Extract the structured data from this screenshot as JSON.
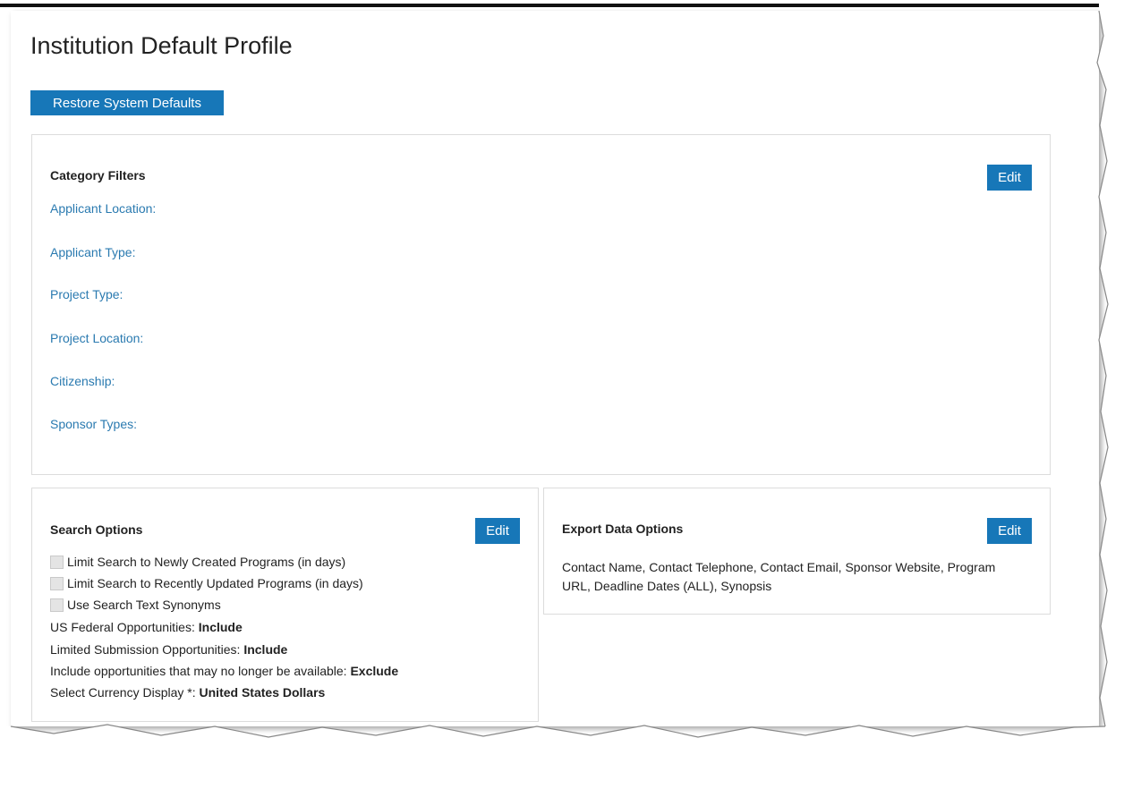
{
  "page": {
    "title": "Institution Default Profile",
    "restore_label": "Restore System Defaults"
  },
  "category_filters": {
    "title": "Category Filters",
    "edit_label": "Edit",
    "items": [
      "Applicant Location:",
      "Applicant Type:",
      "Project Type:",
      "Project Location:",
      "Citizenship:",
      "Sponsor Types:"
    ]
  },
  "search_options": {
    "title": "Search Options",
    "edit_label": "Edit",
    "checkboxes": [
      {
        "label": "Limit Search to Newly Created Programs (in days)",
        "checked": false
      },
      {
        "label": "Limit Search to Recently Updated Programs (in days)",
        "checked": false
      },
      {
        "label": "Use Search Text Synonyms",
        "checked": false
      }
    ],
    "settings": [
      {
        "label": "US Federal Opportunities: ",
        "value": "Include"
      },
      {
        "label": "Limited Submission Opportunities: ",
        "value": "Include"
      },
      {
        "label": "Include opportunities that may no longer be available: ",
        "value": "Exclude"
      },
      {
        "label": "Select Currency Display *: ",
        "value": "United States Dollars"
      }
    ]
  },
  "export_options": {
    "title": "Export Data Options",
    "edit_label": "Edit",
    "text": "Contact Name, Contact Telephone, Contact Email, Sponsor Website, Program URL, Deadline Dates (ALL), Synopsis"
  },
  "colors": {
    "accent": "#1777b8",
    "link": "#2a7ab0",
    "border": "#dcdcdc"
  }
}
